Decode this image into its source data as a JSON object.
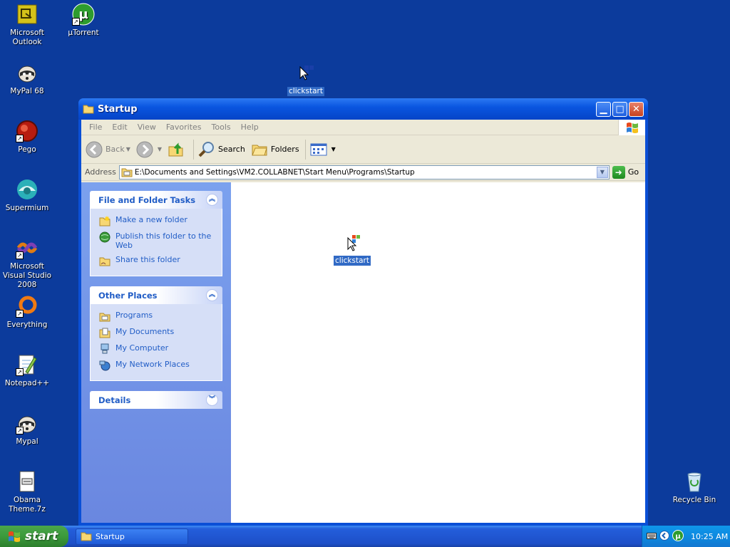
{
  "desktop": {
    "icons": [
      {
        "label": "Microsoft Outlook",
        "icon": "outlook-icon"
      },
      {
        "label": "µTorrent",
        "icon": "utorrent-icon"
      },
      {
        "label": "MyPal 68",
        "icon": "mypal-icon"
      },
      {
        "label": "clickstart",
        "icon": "clickstart-icon"
      },
      {
        "label": "Pego",
        "icon": "pego-icon"
      },
      {
        "label": "Supermium",
        "icon": "supermium-icon"
      },
      {
        "label": "Microsoft Visual Studio 2008",
        "icon": "visual-studio-icon"
      },
      {
        "label": "Everything",
        "icon": "everything-icon"
      },
      {
        "label": "Notepad++",
        "icon": "notepadpp-icon"
      },
      {
        "label": "Mypal",
        "icon": "mypal-icon"
      },
      {
        "label": "Obama Theme.7z",
        "icon": "archive-icon"
      },
      {
        "label": "Recycle Bin",
        "icon": "recycle-bin-icon"
      }
    ]
  },
  "window": {
    "title": "Startup",
    "menu": [
      "File",
      "Edit",
      "View",
      "Favorites",
      "Tools",
      "Help"
    ],
    "toolbar": {
      "back": "Back",
      "search": "Search",
      "folders": "Folders"
    },
    "address": {
      "label": "Address",
      "value": "E:\\Documents and Settings\\VM2.COLLABNET\\Start Menu\\Programs\\Startup",
      "go": "Go"
    },
    "taskpane": {
      "file_tasks": {
        "title": "File and Folder Tasks",
        "items": [
          "Make a new folder",
          "Publish this folder to the Web",
          "Share this folder"
        ]
      },
      "other_places": {
        "title": "Other Places",
        "items": [
          "Programs",
          "My Documents",
          "My Computer",
          "My Network Places"
        ]
      },
      "details": {
        "title": "Details"
      }
    },
    "files": [
      {
        "label": "clickstart",
        "icon": "clickstart-icon"
      }
    ]
  },
  "taskbar": {
    "start_label": "start",
    "tasks": [
      "Startup"
    ],
    "clock": "10:25 AM"
  },
  "colors": {
    "desktop": "#0c3b9c",
    "titlebar": "#0a56e0",
    "taskpane": "#7ba1ee",
    "selection": "#316ac5",
    "start_button": "#3c9a3c"
  }
}
